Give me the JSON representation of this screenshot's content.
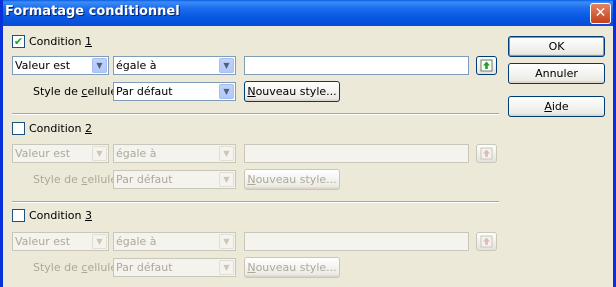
{
  "window": {
    "title": "Formatage conditionnel",
    "close_glyph": "✕"
  },
  "conditions": [
    {
      "label_prefix": "Condition ",
      "label_number": "1",
      "checked": true,
      "type_select": "Valeur est",
      "operator_select": "égale à",
      "value": "",
      "style_label_prefix": "Style de ",
      "style_label_accel": "c",
      "style_label_suffix": "ellule",
      "style_select": "Par défaut",
      "new_style_accel": "N",
      "new_style_rest": "ouveau style..."
    },
    {
      "label_prefix": "Condition ",
      "label_number": "2",
      "checked": false,
      "type_select": "Valeur est",
      "operator_select": "égale à",
      "value": "",
      "style_label_prefix": "Style de ",
      "style_label_accel": "c",
      "style_label_suffix": "ellule",
      "style_select": "Par défaut",
      "new_style_accel": "N",
      "new_style_rest": "ouveau style..."
    },
    {
      "label_prefix": "Condition ",
      "label_number": "3",
      "checked": false,
      "type_select": "Valeur est",
      "operator_select": "égale à",
      "value": "",
      "style_label_prefix": "Style de ",
      "style_label_accel": "c",
      "style_label_suffix": "ellule",
      "style_select": "Par défaut",
      "new_style_accel": "N",
      "new_style_rest": "ouveau style..."
    }
  ],
  "buttons": {
    "ok": "OK",
    "cancel": "Annuler",
    "help_accel": "A",
    "help_rest": "ide"
  },
  "colors": {
    "titlebar": "#0a5fe6",
    "window_bg": "#ece9d8",
    "checkmark": "#21a121"
  }
}
